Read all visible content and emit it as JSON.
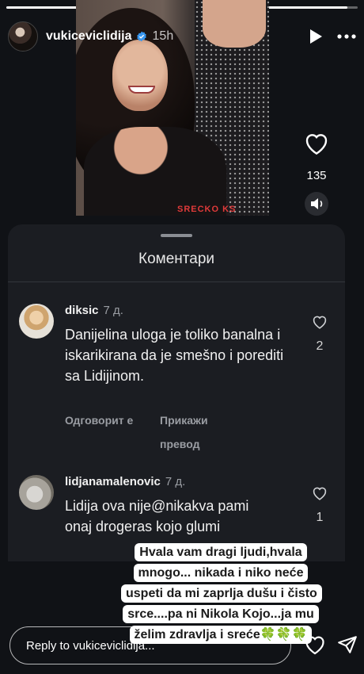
{
  "story": {
    "progress_fraction": 0.97
  },
  "header": {
    "username": "vukiceviclidija",
    "time_ago": "15h",
    "play_icon": "play-icon",
    "more_icon": "more-icon",
    "verified_icon": "verified-badge-icon"
  },
  "photo": {
    "watermark": "SRECKO KS"
  },
  "side_actions": {
    "like_icon": "heart-icon",
    "like_count": "135",
    "sound_icon": "speaker-icon"
  },
  "comments_sheet": {
    "title": "Коментари",
    "comments": [
      {
        "username": "diksic",
        "time": "7 д.",
        "text": "Danijelina uloga je toliko banalna i iskarikirana da je smešno i porediti sa Lidijinom.",
        "reply_label": "Одговорит е",
        "translate_label": "Прикажи превод",
        "like_count": "2"
      },
      {
        "username": "lidjanamalenovic",
        "time": "7 д.",
        "text": "Lidija ova nije@nikakva pami onaj drogeras kojo glumi",
        "like_count": "1"
      }
    ]
  },
  "caption": {
    "text": "Hvala vam dragi ljudi,hvala mnogo... nikada i niko neće uspeti da mi zaprlja dušu i čisto srce....pa ni Nikola Kojo...ja mu želim zdravlja i sreće🍀🍀🍀"
  },
  "reply_bar": {
    "placeholder": "Reply to vukiceviclidija...",
    "like_icon": "heart-icon",
    "send_icon": "send-icon"
  },
  "colors": {
    "background": "#101216",
    "sheet": "#1b1d22",
    "muted_text": "#9a9da3",
    "caption_bg": "#ffffff"
  }
}
